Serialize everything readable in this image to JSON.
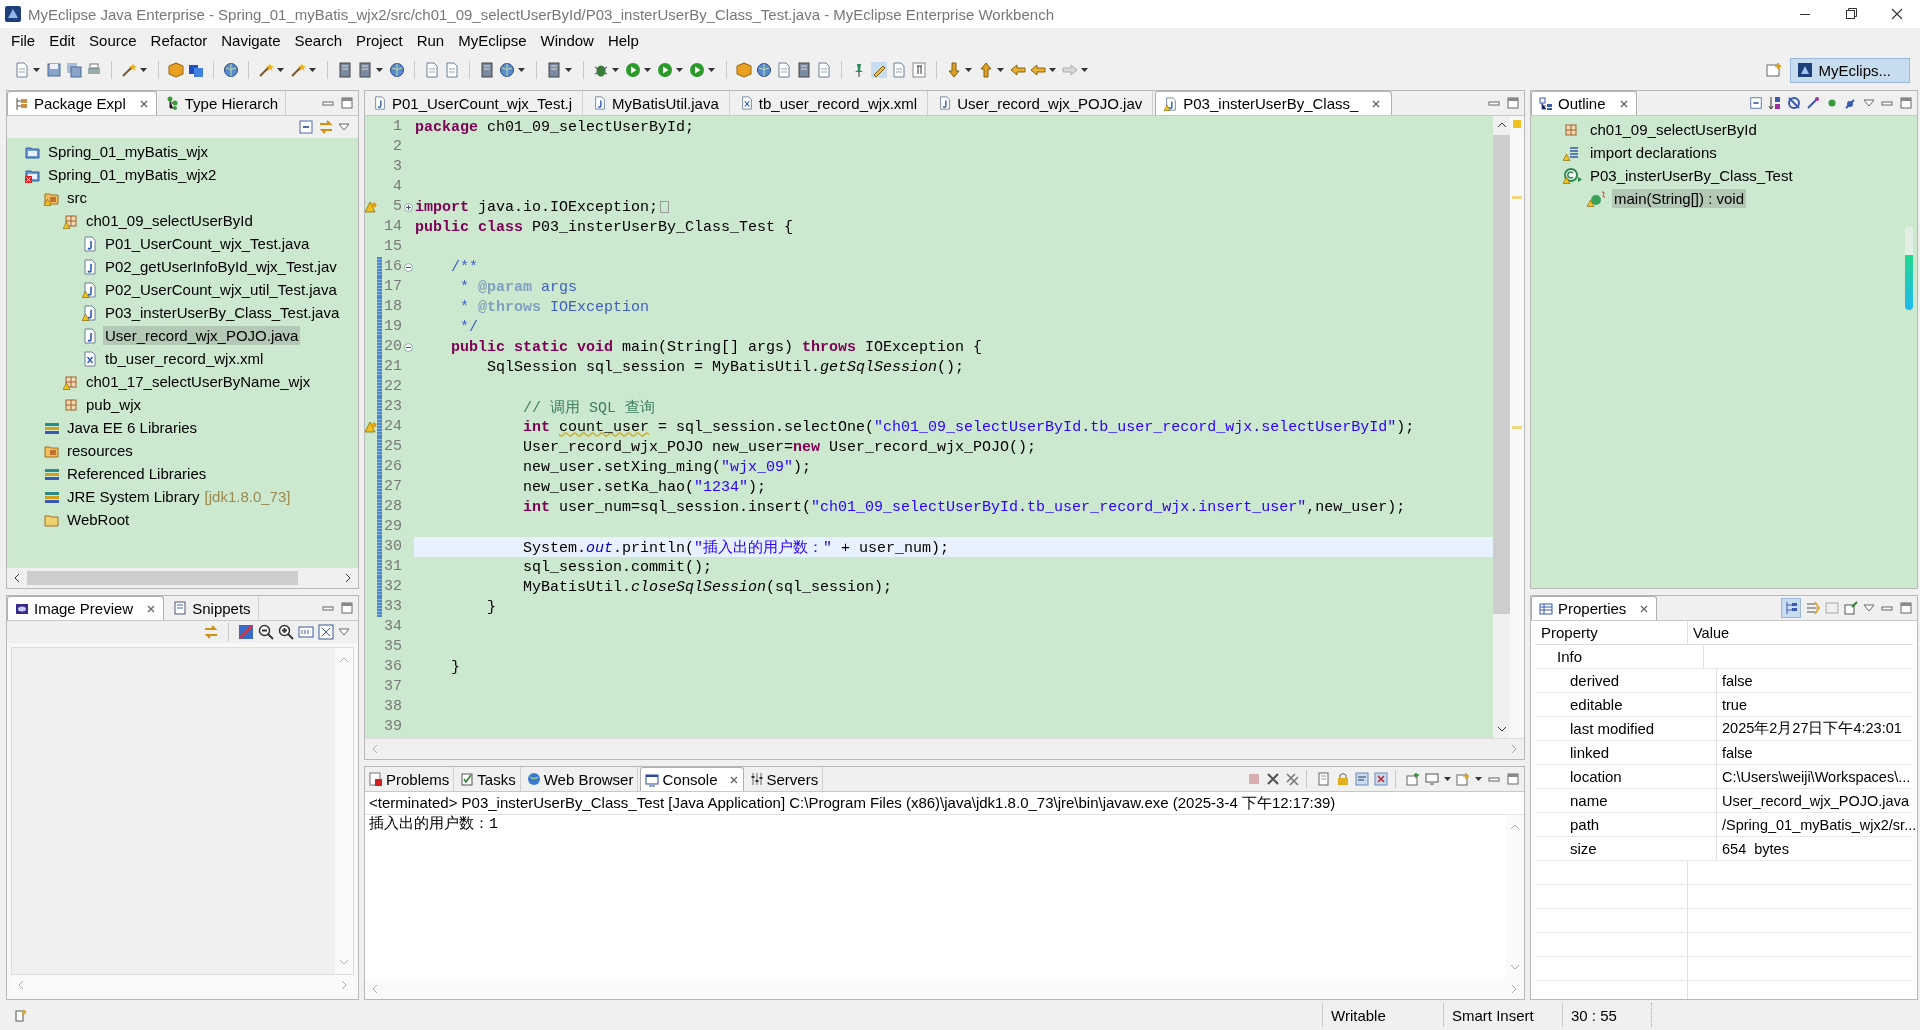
{
  "window": {
    "title": "MyEclipse Java Enterprise - Spring_01_myBatis_wjx2/src/ch01_09_selectUserById/P03_insterUserBy_Class_Test.java - MyEclipse Enterprise Workbench"
  },
  "menu": [
    "File",
    "Edit",
    "Source",
    "Refactor",
    "Navigate",
    "Search",
    "Project",
    "Run",
    "MyEclipse",
    "Window",
    "Help"
  ],
  "perspective": {
    "label": "MyEclips...",
    "selected": true
  },
  "package_panel": {
    "tabs": [
      {
        "label": "Package Expl",
        "selected": true
      },
      {
        "label": "Type Hierarch",
        "selected": false
      }
    ],
    "tree": [
      {
        "label": "Spring_01_myBatis_wjx",
        "kind": "project",
        "warning": false,
        "error": false,
        "selected": false
      },
      {
        "label": "Spring_01_myBatis_wjx2",
        "kind": "project",
        "warning": false,
        "error": true,
        "selected": false,
        "children": [
          {
            "label": "src",
            "kind": "source-folder",
            "warning": true,
            "error": false,
            "selected": false,
            "children": [
              {
                "label": "ch01_09_selectUserById",
                "kind": "package",
                "warning": true,
                "error": false,
                "selected": false,
                "children": [
                  {
                    "label": "P01_UserCount_wjx_Test.java",
                    "kind": "java",
                    "warning": false,
                    "error": false,
                    "selected": false
                  },
                  {
                    "label": "P02_getUserInfoById_wjx_Test.jav",
                    "kind": "java",
                    "warning": false,
                    "error": false,
                    "selected": false
                  },
                  {
                    "label": "P02_UserCount_wjx_util_Test.java",
                    "kind": "java",
                    "warning": true,
                    "error": false,
                    "selected": false
                  },
                  {
                    "label": "P03_insterUserBy_Class_Test.java",
                    "kind": "java",
                    "warning": true,
                    "error": false,
                    "selected": false
                  },
                  {
                    "label": "User_record_wjx_POJO.java",
                    "kind": "java",
                    "warning": false,
                    "error": false,
                    "selected": true
                  },
                  {
                    "label": "tb_user_record_wjx.xml",
                    "kind": "xml",
                    "warning": false,
                    "error": false,
                    "selected": false
                  }
                ]
              },
              {
                "label": "ch01_17_selectUserByName_wjx",
                "kind": "package",
                "warning": true,
                "error": false,
                "selected": false
              },
              {
                "label": "pub_wjx",
                "kind": "package",
                "warning": false,
                "error": false,
                "selected": false
              }
            ]
          },
          {
            "label": "Java EE 6 Libraries",
            "kind": "library",
            "warning": false,
            "error": false,
            "selected": false
          },
          {
            "label": "resources",
            "kind": "source-folder",
            "warning": false,
            "error": false,
            "selected": false
          },
          {
            "label": "Referenced Libraries",
            "kind": "library",
            "warning": false,
            "error": false,
            "selected": false
          },
          {
            "label": "JRE System Library",
            "kind": "library",
            "decoration": "[jdk1.8.0_73]",
            "warning": false,
            "error": false,
            "selected": false
          },
          {
            "label": "WebRoot",
            "kind": "folder",
            "warning": false,
            "error": false,
            "selected": false
          }
        ]
      }
    ]
  },
  "preview_panel": {
    "tabs": [
      {
        "label": "Image Preview",
        "selected": true
      },
      {
        "label": "Snippets",
        "selected": false
      }
    ]
  },
  "editor": {
    "tabs": [
      {
        "label": "P01_UserCount_wjx_Test.j",
        "kind": "java",
        "warning": false,
        "selected": false
      },
      {
        "label": "MyBatisUtil.java",
        "kind": "java",
        "warning": false,
        "selected": false
      },
      {
        "label": "tb_user_record_wjx.xml",
        "kind": "xml",
        "warning": false,
        "selected": false
      },
      {
        "label": "User_record_wjx_POJO.jav",
        "kind": "java",
        "warning": false,
        "selected": false
      },
      {
        "label": "P03_insterUserBy_Class_",
        "kind": "java",
        "warning": true,
        "selected": true
      }
    ],
    "lines": [
      {
        "num": "1",
        "kind": "line",
        "changed": false,
        "current": false,
        "warning": false,
        "tokens": [
          {
            "t": "package",
            "kind": "kw"
          },
          {
            "t": " ch01_09_selectUserById;",
            "kind": "plain"
          }
        ]
      },
      {
        "num": "2",
        "kind": "line",
        "changed": false,
        "current": false,
        "warning": false
      },
      {
        "num": "3",
        "kind": "line",
        "changed": false,
        "current": false,
        "warning": false
      },
      {
        "num": "4",
        "kind": "line",
        "changed": false,
        "current": false,
        "warning": false
      },
      {
        "num": "5",
        "kind": "collapsed-fold",
        "changed": false,
        "current": false,
        "warning": true,
        "tokens": [
          {
            "t": "import",
            "kind": "kw"
          },
          {
            "t": " java.io.IOException;",
            "kind": "plain"
          }
        ]
      },
      {
        "num": "14",
        "kind": "line",
        "changed": false,
        "current": false,
        "warning": false,
        "tokens": [
          {
            "t": "public class",
            "kind": "kw"
          },
          {
            "t": " P03_insterUserBy_Class_Test {",
            "kind": "plain"
          }
        ]
      },
      {
        "num": "15",
        "kind": "line",
        "changed": false,
        "current": false,
        "warning": false
      },
      {
        "num": "16",
        "kind": "expanded-fold",
        "changed": true,
        "current": false,
        "warning": false,
        "tokens": [
          {
            "t": "    /**",
            "kind": "doc"
          }
        ]
      },
      {
        "num": "17",
        "kind": "line",
        "changed": true,
        "current": false,
        "warning": false,
        "tokens": [
          {
            "t": "     * ",
            "kind": "doc"
          },
          {
            "t": "@param",
            "kind": "doctag"
          },
          {
            "t": " args",
            "kind": "doc"
          }
        ]
      },
      {
        "num": "18",
        "kind": "line",
        "changed": true,
        "current": false,
        "warning": false,
        "tokens": [
          {
            "t": "     * ",
            "kind": "doc"
          },
          {
            "t": "@throws",
            "kind": "doctag"
          },
          {
            "t": " IOException",
            "kind": "doc"
          }
        ]
      },
      {
        "num": "19",
        "kind": "line",
        "changed": true,
        "current": false,
        "warning": false,
        "tokens": [
          {
            "t": "     */",
            "kind": "doc"
          }
        ]
      },
      {
        "num": "20",
        "kind": "expanded-fold",
        "changed": true,
        "current": false,
        "warning": false,
        "tokens": [
          {
            "t": "    public static void",
            "kind": "kw"
          },
          {
            "t": " main(String[] args) ",
            "kind": "plain"
          },
          {
            "t": "throws",
            "kind": "kw"
          },
          {
            "t": " IOException {",
            "kind": "plain"
          }
        ]
      },
      {
        "num": "21",
        "kind": "line",
        "changed": true,
        "current": false,
        "warning": false,
        "tokens": [
          {
            "t": "        SqlSession sql_session = MyBatisUtil.",
            "kind": "plain"
          },
          {
            "t": "getSqlSession",
            "kind": "italic"
          },
          {
            "t": "();",
            "kind": "plain"
          }
        ]
      },
      {
        "num": "22",
        "kind": "line",
        "changed": true,
        "current": false,
        "warning": false
      },
      {
        "num": "23",
        "kind": "line",
        "changed": true,
        "current": false,
        "warning": false,
        "tokens": [
          {
            "t": "            // 调用 SQL 查询",
            "kind": "comment"
          }
        ]
      },
      {
        "num": "24",
        "kind": "line",
        "changed": true,
        "current": false,
        "warning": true,
        "tokens": [
          {
            "t": "            int ",
            "kind": "kw"
          },
          {
            "t": "count_user",
            "kind": "warn"
          },
          {
            "t": " = sql_session.selectOne(",
            "kind": "plain"
          },
          {
            "t": "\"ch01_09_selectUserById.tb_user_record_wjx.selectUserById\"",
            "kind": "str"
          },
          {
            "t": ");",
            "kind": "plain"
          }
        ]
      },
      {
        "num": "25",
        "kind": "line",
        "changed": true,
        "current": false,
        "warning": false,
        "tokens": [
          {
            "t": "            User_record_wjx_POJO new_user=",
            "kind": "plain"
          },
          {
            "t": "new",
            "kind": "kw"
          },
          {
            "t": " User_record_wjx_POJO();",
            "kind": "plain"
          }
        ]
      },
      {
        "num": "26",
        "kind": "line",
        "changed": true,
        "current": false,
        "warning": false,
        "tokens": [
          {
            "t": "            new_user.setXing_ming(",
            "kind": "plain"
          },
          {
            "t": "\"wjx_09\"",
            "kind": "str"
          },
          {
            "t": ");",
            "kind": "plain"
          }
        ]
      },
      {
        "num": "27",
        "kind": "line",
        "changed": true,
        "current": false,
        "warning": false,
        "tokens": [
          {
            "t": "            new_user.setKa_hao(",
            "kind": "plain"
          },
          {
            "t": "\"1234\"",
            "kind": "str"
          },
          {
            "t": ");",
            "kind": "plain"
          }
        ]
      },
      {
        "num": "28",
        "kind": "line",
        "changed": true,
        "current": false,
        "warning": false,
        "tokens": [
          {
            "t": "            int",
            "kind": "kw"
          },
          {
            "t": " user_num=sql_session.insert(",
            "kind": "plain"
          },
          {
            "t": "\"ch01_09_selectUserById.tb_user_record_wjx.insert_user\"",
            "kind": "str"
          },
          {
            "t": ",new_user);",
            "kind": "plain"
          }
        ]
      },
      {
        "num": "29",
        "kind": "line",
        "changed": true,
        "current": false,
        "warning": false
      },
      {
        "num": "30",
        "kind": "line",
        "changed": true,
        "current": true,
        "warning": false,
        "tokens": [
          {
            "t": "            System.",
            "kind": "plain"
          },
          {
            "t": "out",
            "kind": "field"
          },
          {
            "t": ".println(",
            "kind": "plain"
          },
          {
            "t": "\"插入出的用户数：\"",
            "kind": "str"
          },
          {
            "t": " + user_num);",
            "kind": "plain"
          }
        ]
      },
      {
        "num": "31",
        "kind": "line",
        "changed": true,
        "current": false,
        "warning": false,
        "tokens": [
          {
            "t": "            sql_session.commit();",
            "kind": "plain"
          }
        ]
      },
      {
        "num": "32",
        "kind": "line",
        "changed": true,
        "current": false,
        "warning": false,
        "tokens": [
          {
            "t": "            MyBatisUtil.",
            "kind": "plain"
          },
          {
            "t": "closeSqlSession",
            "kind": "italic"
          },
          {
            "t": "(sql_session);",
            "kind": "plain"
          }
        ]
      },
      {
        "num": "33",
        "kind": "line",
        "changed": true,
        "current": false,
        "warning": false,
        "tokens": [
          {
            "t": "        }",
            "kind": "plain"
          }
        ]
      },
      {
        "num": "34",
        "kind": "line",
        "changed": false,
        "current": false,
        "warning": false
      },
      {
        "num": "35",
        "kind": "line",
        "changed": false,
        "current": false,
        "warning": false
      },
      {
        "num": "36",
        "kind": "line",
        "changed": false,
        "current": false,
        "warning": false,
        "tokens": [
          {
            "t": "    }",
            "kind": "plain"
          }
        ]
      },
      {
        "num": "37",
        "kind": "line",
        "changed": false,
        "current": false,
        "warning": false
      },
      {
        "num": "38",
        "kind": "line",
        "changed": false,
        "current": false,
        "warning": false
      },
      {
        "num": "39",
        "kind": "line",
        "changed": false,
        "current": false,
        "warning": false
      }
    ]
  },
  "console": {
    "tabs": [
      {
        "label": "Problems",
        "kind": "problems",
        "selected": false
      },
      {
        "label": "Tasks",
        "kind": "tasks",
        "selected": false
      },
      {
        "label": "Web Browser",
        "kind": "browser",
        "selected": false
      },
      {
        "label": "Console",
        "kind": "console",
        "selected": true
      },
      {
        "label": "Servers",
        "kind": "servers",
        "selected": false
      }
    ],
    "header": "<terminated> P03_insterUserBy_Class_Test [Java Application] C:\\Program Files (x86)\\java\\jdk1.8.0_73\\jre\\bin\\javaw.exe (2025-3-4 下午12:17:39)",
    "output": [
      "插入出的用户数：1"
    ]
  },
  "outline": {
    "title": "Outline",
    "tree": [
      {
        "label": "ch01_09_selectUserById",
        "kind": "package",
        "warning": false,
        "selected": false
      },
      {
        "label": "import declarations",
        "kind": "imports",
        "warning": true,
        "selected": false
      },
      {
        "label": "P03_insterUserBy_Class_Test",
        "kind": "class",
        "warning": true,
        "selected": false,
        "children": [
          {
            "label": "main(String[]) : void",
            "kind": "method",
            "warning": true,
            "selected": true
          }
        ]
      }
    ]
  },
  "properties": {
    "title": "Properties",
    "columns": [
      "Property",
      "Value"
    ],
    "group": "Info",
    "rows": [
      {
        "property": "derived",
        "value": "false"
      },
      {
        "property": "editable",
        "value": "true"
      },
      {
        "property": "last modified",
        "value": "2025年2月27日下午4:23:01"
      },
      {
        "property": "linked",
        "value": "false"
      },
      {
        "property": "location",
        "value": "C:\\Users\\weiji\\Workspaces\\..."
      },
      {
        "property": "name",
        "value": "User_record_wjx_POJO.java"
      },
      {
        "property": "path",
        "value": "/Spring_01_myBatis_wjx2/sr..."
      },
      {
        "property": "size",
        "value": "654  bytes"
      }
    ]
  },
  "status_bar": [
    "Writable",
    "Smart Insert",
    "30 : 55"
  ]
}
